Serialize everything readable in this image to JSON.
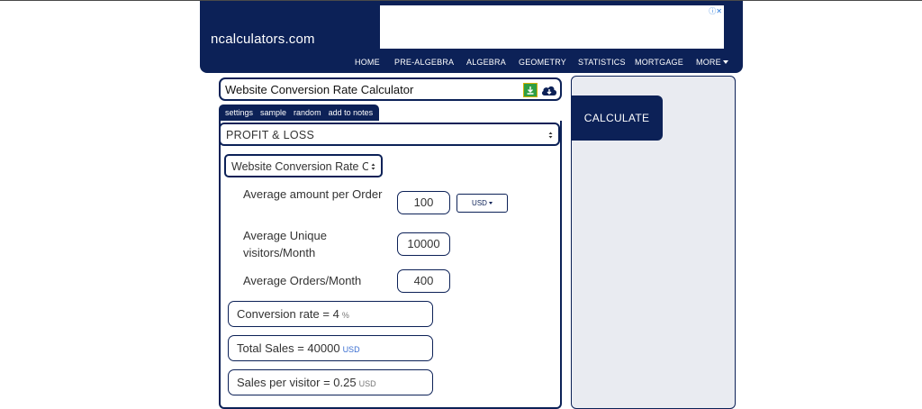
{
  "site": {
    "title": "ncalculators.com"
  },
  "nav": {
    "items": [
      "HOME",
      "PRE-ALGEBRA",
      "ALGEBRA",
      "GEOMETRY",
      "STATISTICS",
      "MORTGAGE"
    ],
    "more_label": "MORE"
  },
  "calculator": {
    "title": "Website Conversion Rate Calculator",
    "tabs": [
      "settings",
      "sample",
      "random",
      "add to notes"
    ],
    "category": "PROFIT & LOSS",
    "selected_calculator": "Website Conversion Rate Calculator"
  },
  "inputs": {
    "avg_amount": {
      "label": "Average amount per Order",
      "value": "100",
      "unit": "USD"
    },
    "visitors": {
      "label": "Average Unique visitors/Month",
      "value": "10000"
    },
    "orders": {
      "label": "Average Orders/Month",
      "value": "400"
    }
  },
  "results": {
    "conversion": {
      "label": "Conversion rate  =  4",
      "unit": "%"
    },
    "total_sales": {
      "label": "Total Sales  =  40000",
      "unit": "USD"
    },
    "per_visitor": {
      "label": "Sales per visitor  =  0.25",
      "unit": "USD"
    }
  },
  "actions": {
    "calculate_label": "CALCULATE"
  },
  "colors": {
    "navy": "#0c2157",
    "panel": "#e9ebf1",
    "link_blue": "#3b6fd1"
  },
  "icons": [
    "adchoices-icon",
    "download-icon",
    "cloud-download-icon",
    "caret-down-icon",
    "select-updown-icon"
  ]
}
